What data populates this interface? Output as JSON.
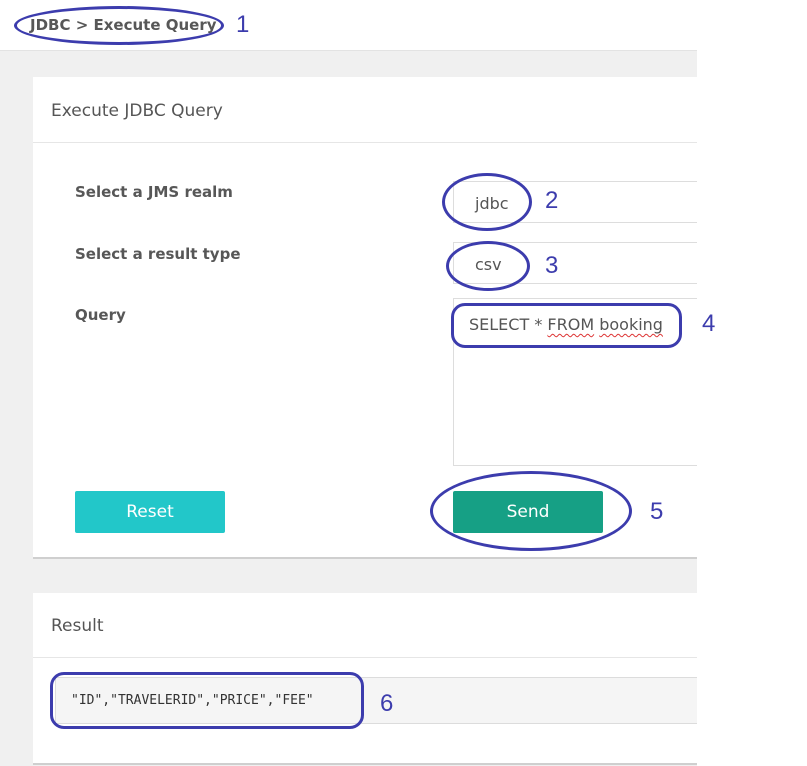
{
  "breadcrumb": "JDBC > Execute Query",
  "query_panel": {
    "title": "Execute JDBC Query",
    "realm_label": "Select a JMS realm",
    "realm_value": "jdbc",
    "result_type_label": "Select a result type",
    "result_type_value": "csv",
    "query_label": "Query",
    "query_value_part1": "SELECT * ",
    "query_value_part2": "FROM",
    "query_value_part3": " ",
    "query_value_part4": "booking",
    "reset_label": "Reset",
    "send_label": "Send"
  },
  "result_panel": {
    "title": "Result",
    "value": "\"ID\",\"TRAVELERID\",\"PRICE\",\"FEE\""
  },
  "annotations": {
    "n1": "1",
    "n2": "2",
    "n3": "3",
    "n4": "4",
    "n5": "5",
    "n6": "6"
  },
  "colors": {
    "annotation": "#3c3cad",
    "reset_button": "#22c7c9",
    "send_button": "#16a085"
  }
}
